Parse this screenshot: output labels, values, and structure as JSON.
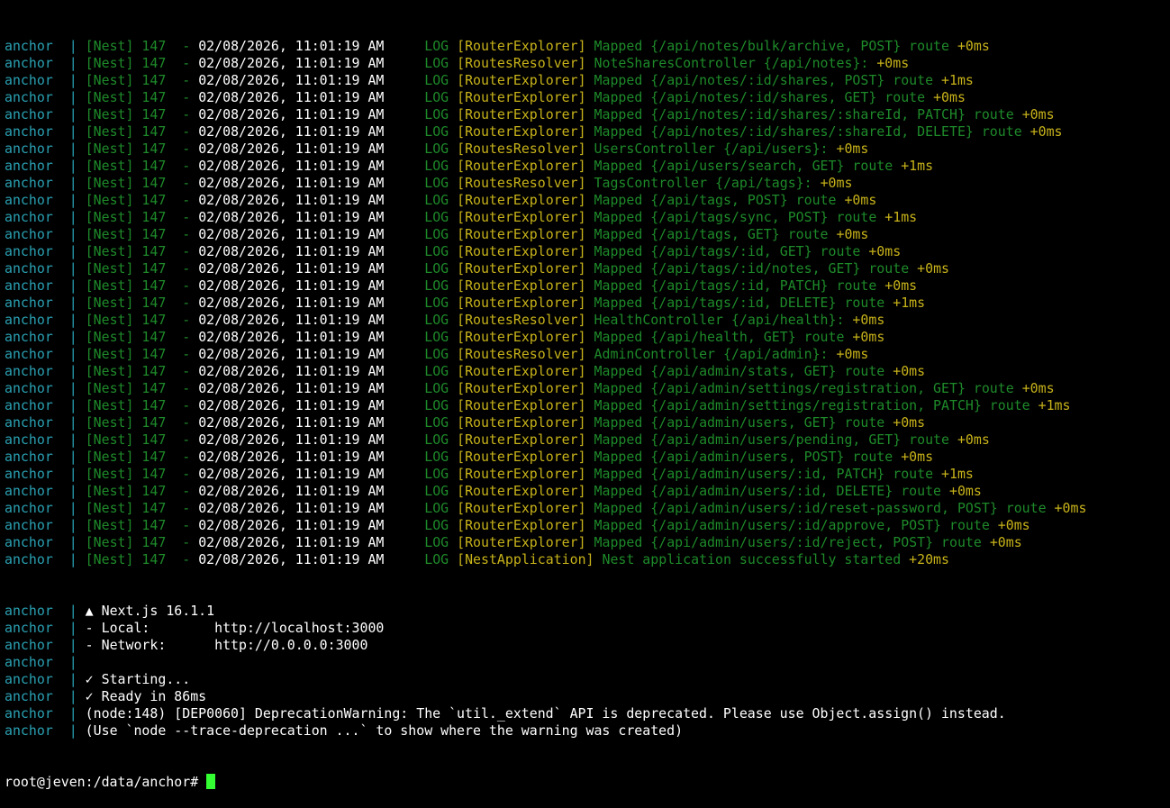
{
  "colors": {
    "background": "#000000",
    "service_prefix": "#2aa1b3",
    "nest_green": "#1e8a2a",
    "context_yellow": "#c7b21a",
    "text_white": "#ffffff",
    "cursor_green": "#33ff33"
  },
  "nest_logs": [
    {
      "service": "anchor",
      "pid": "[Nest] 147",
      "timestamp": "02/08/2026, 11:01:19 AM",
      "level": "LOG",
      "context": "[RouterExplorer]",
      "message": "Mapped {/api/notes/bulk/archive, POST} route",
      "elapsed": "+0ms"
    },
    {
      "service": "anchor",
      "pid": "[Nest] 147",
      "timestamp": "02/08/2026, 11:01:19 AM",
      "level": "LOG",
      "context": "[RoutesResolver]",
      "message": "NoteSharesController {/api/notes}:",
      "elapsed": "+0ms"
    },
    {
      "service": "anchor",
      "pid": "[Nest] 147",
      "timestamp": "02/08/2026, 11:01:19 AM",
      "level": "LOG",
      "context": "[RouterExplorer]",
      "message": "Mapped {/api/notes/:id/shares, POST} route",
      "elapsed": "+1ms"
    },
    {
      "service": "anchor",
      "pid": "[Nest] 147",
      "timestamp": "02/08/2026, 11:01:19 AM",
      "level": "LOG",
      "context": "[RouterExplorer]",
      "message": "Mapped {/api/notes/:id/shares, GET} route",
      "elapsed": "+0ms"
    },
    {
      "service": "anchor",
      "pid": "[Nest] 147",
      "timestamp": "02/08/2026, 11:01:19 AM",
      "level": "LOG",
      "context": "[RouterExplorer]",
      "message": "Mapped {/api/notes/:id/shares/:shareId, PATCH} route",
      "elapsed": "+0ms"
    },
    {
      "service": "anchor",
      "pid": "[Nest] 147",
      "timestamp": "02/08/2026, 11:01:19 AM",
      "level": "LOG",
      "context": "[RouterExplorer]",
      "message": "Mapped {/api/notes/:id/shares/:shareId, DELETE} route",
      "elapsed": "+0ms"
    },
    {
      "service": "anchor",
      "pid": "[Nest] 147",
      "timestamp": "02/08/2026, 11:01:19 AM",
      "level": "LOG",
      "context": "[RoutesResolver]",
      "message": "UsersController {/api/users}:",
      "elapsed": "+0ms"
    },
    {
      "service": "anchor",
      "pid": "[Nest] 147",
      "timestamp": "02/08/2026, 11:01:19 AM",
      "level": "LOG",
      "context": "[RouterExplorer]",
      "message": "Mapped {/api/users/search, GET} route",
      "elapsed": "+1ms"
    },
    {
      "service": "anchor",
      "pid": "[Nest] 147",
      "timestamp": "02/08/2026, 11:01:19 AM",
      "level": "LOG",
      "context": "[RoutesResolver]",
      "message": "TagsController {/api/tags}:",
      "elapsed": "+0ms"
    },
    {
      "service": "anchor",
      "pid": "[Nest] 147",
      "timestamp": "02/08/2026, 11:01:19 AM",
      "level": "LOG",
      "context": "[RouterExplorer]",
      "message": "Mapped {/api/tags, POST} route",
      "elapsed": "+0ms"
    },
    {
      "service": "anchor",
      "pid": "[Nest] 147",
      "timestamp": "02/08/2026, 11:01:19 AM",
      "level": "LOG",
      "context": "[RouterExplorer]",
      "message": "Mapped {/api/tags/sync, POST} route",
      "elapsed": "+1ms"
    },
    {
      "service": "anchor",
      "pid": "[Nest] 147",
      "timestamp": "02/08/2026, 11:01:19 AM",
      "level": "LOG",
      "context": "[RouterExplorer]",
      "message": "Mapped {/api/tags, GET} route",
      "elapsed": "+0ms"
    },
    {
      "service": "anchor",
      "pid": "[Nest] 147",
      "timestamp": "02/08/2026, 11:01:19 AM",
      "level": "LOG",
      "context": "[RouterExplorer]",
      "message": "Mapped {/api/tags/:id, GET} route",
      "elapsed": "+0ms"
    },
    {
      "service": "anchor",
      "pid": "[Nest] 147",
      "timestamp": "02/08/2026, 11:01:19 AM",
      "level": "LOG",
      "context": "[RouterExplorer]",
      "message": "Mapped {/api/tags/:id/notes, GET} route",
      "elapsed": "+0ms"
    },
    {
      "service": "anchor",
      "pid": "[Nest] 147",
      "timestamp": "02/08/2026, 11:01:19 AM",
      "level": "LOG",
      "context": "[RouterExplorer]",
      "message": "Mapped {/api/tags/:id, PATCH} route",
      "elapsed": "+0ms"
    },
    {
      "service": "anchor",
      "pid": "[Nest] 147",
      "timestamp": "02/08/2026, 11:01:19 AM",
      "level": "LOG",
      "context": "[RouterExplorer]",
      "message": "Mapped {/api/tags/:id, DELETE} route",
      "elapsed": "+1ms"
    },
    {
      "service": "anchor",
      "pid": "[Nest] 147",
      "timestamp": "02/08/2026, 11:01:19 AM",
      "level": "LOG",
      "context": "[RoutesResolver]",
      "message": "HealthController {/api/health}:",
      "elapsed": "+0ms"
    },
    {
      "service": "anchor",
      "pid": "[Nest] 147",
      "timestamp": "02/08/2026, 11:01:19 AM",
      "level": "LOG",
      "context": "[RouterExplorer]",
      "message": "Mapped {/api/health, GET} route",
      "elapsed": "+0ms"
    },
    {
      "service": "anchor",
      "pid": "[Nest] 147",
      "timestamp": "02/08/2026, 11:01:19 AM",
      "level": "LOG",
      "context": "[RoutesResolver]",
      "message": "AdminController {/api/admin}:",
      "elapsed": "+0ms"
    },
    {
      "service": "anchor",
      "pid": "[Nest] 147",
      "timestamp": "02/08/2026, 11:01:19 AM",
      "level": "LOG",
      "context": "[RouterExplorer]",
      "message": "Mapped {/api/admin/stats, GET} route",
      "elapsed": "+0ms"
    },
    {
      "service": "anchor",
      "pid": "[Nest] 147",
      "timestamp": "02/08/2026, 11:01:19 AM",
      "level": "LOG",
      "context": "[RouterExplorer]",
      "message": "Mapped {/api/admin/settings/registration, GET} route",
      "elapsed": "+0ms"
    },
    {
      "service": "anchor",
      "pid": "[Nest] 147",
      "timestamp": "02/08/2026, 11:01:19 AM",
      "level": "LOG",
      "context": "[RouterExplorer]",
      "message": "Mapped {/api/admin/settings/registration, PATCH} route",
      "elapsed": "+1ms"
    },
    {
      "service": "anchor",
      "pid": "[Nest] 147",
      "timestamp": "02/08/2026, 11:01:19 AM",
      "level": "LOG",
      "context": "[RouterExplorer]",
      "message": "Mapped {/api/admin/users, GET} route",
      "elapsed": "+0ms"
    },
    {
      "service": "anchor",
      "pid": "[Nest] 147",
      "timestamp": "02/08/2026, 11:01:19 AM",
      "level": "LOG",
      "context": "[RouterExplorer]",
      "message": "Mapped {/api/admin/users/pending, GET} route",
      "elapsed": "+0ms"
    },
    {
      "service": "anchor",
      "pid": "[Nest] 147",
      "timestamp": "02/08/2026, 11:01:19 AM",
      "level": "LOG",
      "context": "[RouterExplorer]",
      "message": "Mapped {/api/admin/users, POST} route",
      "elapsed": "+0ms"
    },
    {
      "service": "anchor",
      "pid": "[Nest] 147",
      "timestamp": "02/08/2026, 11:01:19 AM",
      "level": "LOG",
      "context": "[RouterExplorer]",
      "message": "Mapped {/api/admin/users/:id, PATCH} route",
      "elapsed": "+1ms"
    },
    {
      "service": "anchor",
      "pid": "[Nest] 147",
      "timestamp": "02/08/2026, 11:01:19 AM",
      "level": "LOG",
      "context": "[RouterExplorer]",
      "message": "Mapped {/api/admin/users/:id, DELETE} route",
      "elapsed": "+0ms"
    },
    {
      "service": "anchor",
      "pid": "[Nest] 147",
      "timestamp": "02/08/2026, 11:01:19 AM",
      "level": "LOG",
      "context": "[RouterExplorer]",
      "message": "Mapped {/api/admin/users/:id/reset-password, POST} route",
      "elapsed": "+0ms"
    },
    {
      "service": "anchor",
      "pid": "[Nest] 147",
      "timestamp": "02/08/2026, 11:01:19 AM",
      "level": "LOG",
      "context": "[RouterExplorer]",
      "message": "Mapped {/api/admin/users/:id/approve, POST} route",
      "elapsed": "+0ms"
    },
    {
      "service": "anchor",
      "pid": "[Nest] 147",
      "timestamp": "02/08/2026, 11:01:19 AM",
      "level": "LOG",
      "context": "[RouterExplorer]",
      "message": "Mapped {/api/admin/users/:id/reject, POST} route",
      "elapsed": "+0ms"
    },
    {
      "service": "anchor",
      "pid": "[Nest] 147",
      "timestamp": "02/08/2026, 11:01:19 AM",
      "level": "LOG",
      "context": "[NestApplication]",
      "message": "Nest application successfully started",
      "elapsed": "+20ms"
    }
  ],
  "plain_logs": [
    {
      "service": "anchor",
      "text": "▲ Next.js 16.1.1"
    },
    {
      "service": "anchor",
      "text": "- Local:        http://localhost:3000"
    },
    {
      "service": "anchor",
      "text": "- Network:      http://0.0.0.0:3000"
    },
    {
      "service": "anchor",
      "text": ""
    },
    {
      "service": "anchor",
      "text": "✓ Starting..."
    },
    {
      "service": "anchor",
      "text": "✓ Ready in 86ms"
    },
    {
      "service": "anchor",
      "text": "(node:148) [DEP0060] DeprecationWarning: The `util._extend` API is deprecated. Please use Object.assign() instead."
    },
    {
      "service": "anchor",
      "text": "(Use `node --trace-deprecation ...` to show where the warning was created)"
    }
  ],
  "prompt": {
    "text": "root@jeven:/data/anchor# "
  }
}
